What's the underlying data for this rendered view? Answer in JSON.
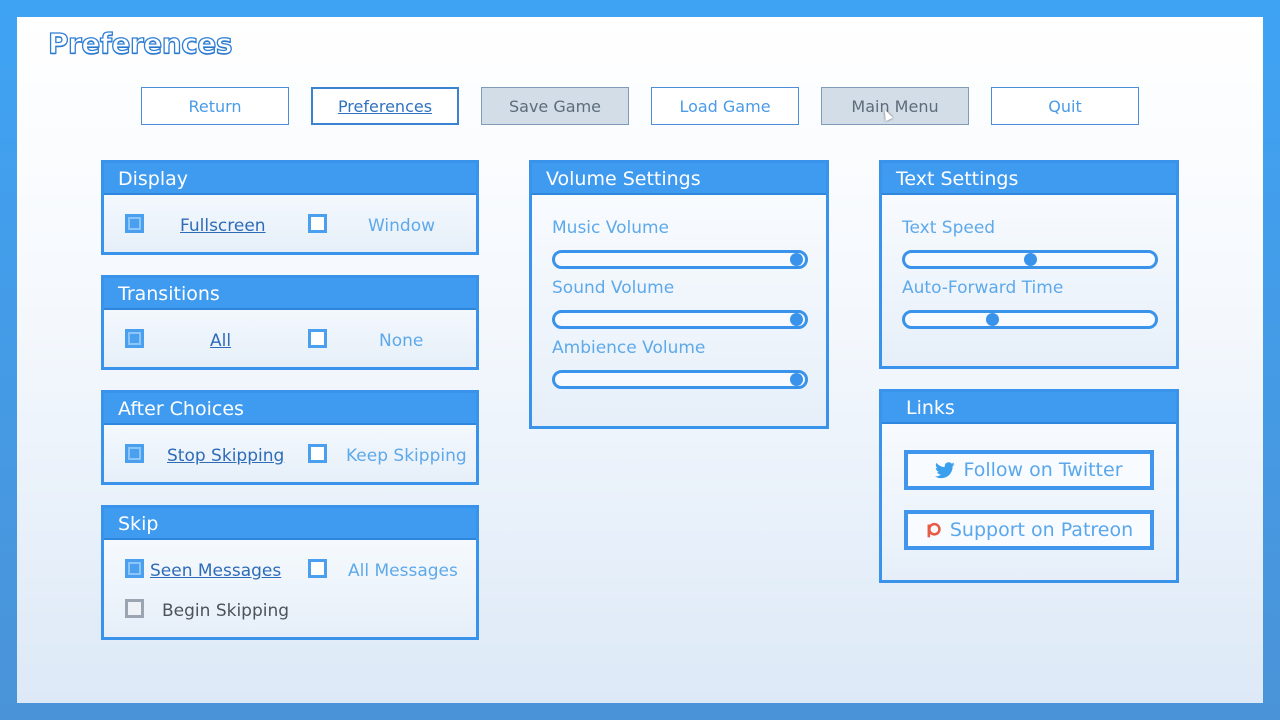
{
  "page_title": "Preferences",
  "nav": [
    {
      "label": "Return",
      "state": "normal"
    },
    {
      "label": "Preferences",
      "state": "selected"
    },
    {
      "label": "Save Game",
      "state": "disabled"
    },
    {
      "label": "Load Game",
      "state": "normal"
    },
    {
      "label": "Main Menu",
      "state": "disabled"
    },
    {
      "label": "Quit",
      "state": "normal"
    }
  ],
  "display": {
    "title": "Display",
    "options": [
      {
        "label": "Fullscreen",
        "checked": true
      },
      {
        "label": "Window",
        "checked": false
      }
    ]
  },
  "transitions": {
    "title": "Transitions",
    "options": [
      {
        "label": "All",
        "checked": true
      },
      {
        "label": "None",
        "checked": false
      }
    ]
  },
  "after_choices": {
    "title": "After Choices",
    "options": [
      {
        "label": "Stop Skipping",
        "checked": true
      },
      {
        "label": "Keep Skipping",
        "checked": false
      }
    ]
  },
  "skip": {
    "title": "Skip",
    "options": [
      {
        "label": "Seen Messages",
        "checked": true
      },
      {
        "label": "All Messages",
        "checked": false
      }
    ],
    "begin_skipping": {
      "label": "Begin Skipping",
      "checked": false
    }
  },
  "volume": {
    "title": "Volume Settings",
    "sliders": [
      {
        "label": "Music Volume",
        "value": 1.0
      },
      {
        "label": "Sound Volume",
        "value": 1.0
      },
      {
        "label": "Ambience Volume",
        "value": 1.0
      }
    ]
  },
  "text_settings": {
    "title": "Text Settings",
    "sliders": [
      {
        "label": "Text Speed",
        "value": 0.5
      },
      {
        "label": "Auto-Forward Time",
        "value": 0.34
      }
    ]
  },
  "links": {
    "title": "Links",
    "twitter": {
      "label": "Follow on Twitter",
      "icon": "twitter-bird-icon",
      "color": "#3aa0ee"
    },
    "patreon": {
      "label": "Support on Patreon",
      "icon": "patreon-icon",
      "color": "#e85b46"
    }
  },
  "colors": {
    "accent": "#3f9bf0",
    "border": "#3a93ea",
    "label": "#5ea9ea",
    "selected": "#2e6cb8",
    "disabled_bg": "#d3dde8"
  }
}
